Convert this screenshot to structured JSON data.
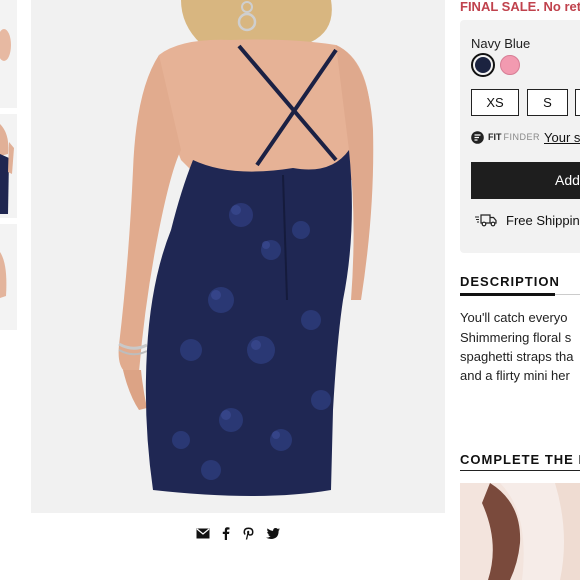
{
  "product": {
    "final_sale_text": "FINAL SALE. No ret",
    "color": {
      "label": "Navy Blue",
      "swatches": [
        "#1b2340",
        "#f29ab0"
      ],
      "selected_index": 0
    },
    "sizes": [
      "XS",
      "S",
      ""
    ],
    "fit_finder": {
      "brand_bold": "FIT",
      "brand_light": "FINDER",
      "link_text": "Your s"
    },
    "add_button_label": "Add",
    "shipping_text": "Free Shippin"
  },
  "description": {
    "title": "DESCRIPTION",
    "lines": [
      "You'll catch everyo",
      "Shimmering floral s",
      "spaghetti straps tha",
      "and a flirty mini her"
    ]
  },
  "complete_look": {
    "title": "COMPLETE THE L"
  },
  "share_icons": [
    "envelope-icon",
    "facebook-icon",
    "pinterest-icon",
    "twitter-icon"
  ],
  "colors": {
    "accent_red": "#c0424d",
    "dress_navy": "#1e2652",
    "button_dark": "#1e1e1e"
  }
}
